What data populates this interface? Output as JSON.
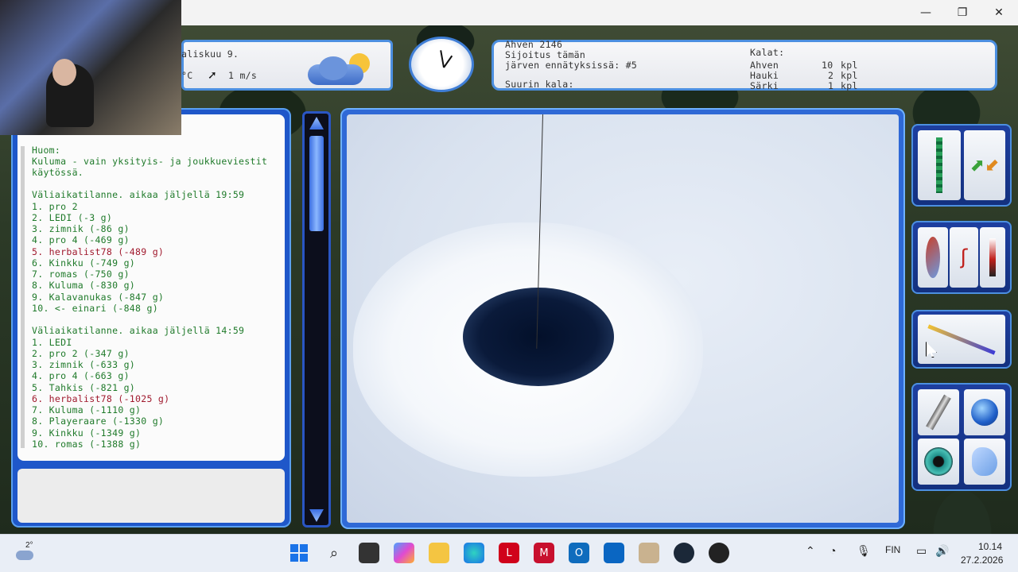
{
  "window": {
    "minimize": "—",
    "restore": "❐",
    "close": "✕"
  },
  "weather": {
    "date": "aliskuu 9.",
    "temp_unit": "°C",
    "wind": "1 m/s"
  },
  "info": {
    "line1": "Ahven 2146",
    "line2": "Sijoitus tämän",
    "line3": "järven ennätyksissä: #5",
    "biggest": "Suurin kala:",
    "fish_header": "Kalat:",
    "fish": [
      {
        "name": "Ahven",
        "count": "10",
        "unit": "kpl"
      },
      {
        "name": "Hauki",
        "count": "2",
        "unit": "kpl"
      },
      {
        "name": "Särki",
        "count": "1",
        "unit": "kpl"
      }
    ]
  },
  "chat": {
    "note_title": "Huom:",
    "note_line1": "Kuluma - vain yksityis- ja joukkueviestit",
    "note_line2": "käytössä.",
    "standings1_title": "Väliaikatilanne. aikaa jäljellä 19:59",
    "standings1": [
      "1. pro 2",
      "2. LEDI (-3 g)",
      "3. zimnik (-86 g)",
      "4. pro 4 (-469 g)",
      "5. herbalist78 (-489 g)",
      "6. Kinkku (-749 g)",
      "7. romas (-750 g)",
      "8. Kuluma (-830 g)",
      "9. Kalavanukas (-847 g)",
      "10. <- einari (-848 g)"
    ],
    "standings2_title": "Väliaikatilanne. aikaa jäljellä 14:59",
    "standings2": [
      "1. LEDI",
      "2. pro 2 (-347 g)",
      "3. zimnik (-633 g)",
      "4. pro 4 (-663 g)",
      "5. Tahkis (-821 g)",
      "6. herbalist78 (-1025 g)",
      "7. Kuluma (-1110 g)",
      "8. Playeraare (-1330 g)",
      "9. Kinkku (-1349 g)",
      "10. romas (-1388 g)"
    ],
    "highlight_color": "#a0192d",
    "title_color": "#1f7a2a"
  },
  "taskbar": {
    "weather_temp": "2°",
    "language": "FIN",
    "time": "10.14",
    "date": "27.2.2026"
  }
}
